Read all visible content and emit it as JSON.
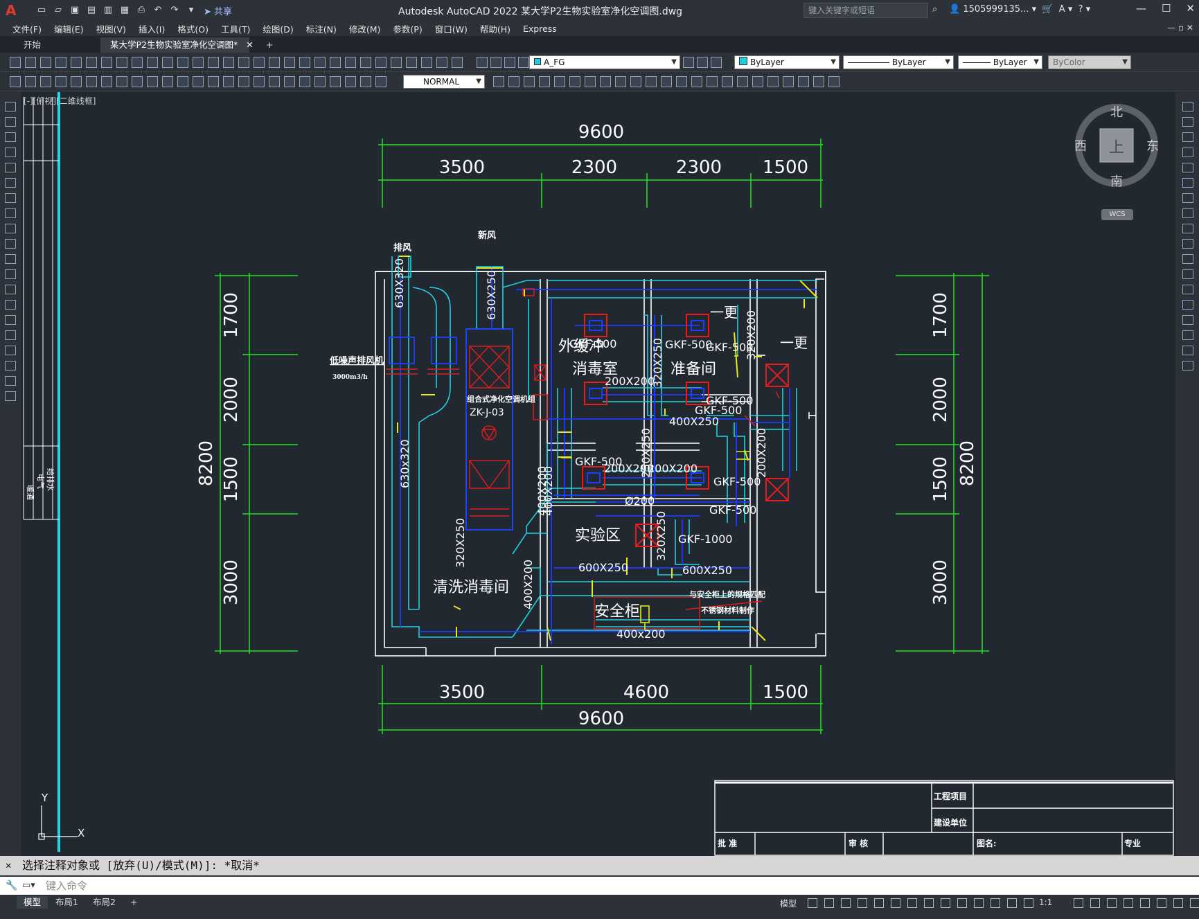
{
  "titlebar": {
    "app_logo": "A",
    "share": "共享",
    "title": "Autodesk AutoCAD 2022    某大学P2生物实验室净化空调图.dwg",
    "search_placeholder": "键入关键字或短语",
    "user": "1505999135...",
    "minimize": "—",
    "maximize": "☐",
    "close": "✕"
  },
  "menu": [
    "文件(F)",
    "编辑(E)",
    "视图(V)",
    "插入(I)",
    "格式(O)",
    "工具(T)",
    "绘图(D)",
    "标注(N)",
    "修改(M)",
    "参数(P)",
    "窗口(W)",
    "帮助(H)",
    "Express"
  ],
  "tabs": {
    "start": "开始",
    "doc": "某大学P2生物实验室净化空调图*",
    "close": "✕",
    "add": "+"
  },
  "ribbon": {
    "layer": "A_FG",
    "color": "ByLayer",
    "linetype": "ByLayer",
    "lineweight": "ByLayer",
    "plotstyle": "ByColor",
    "textstyle": "NORMAL"
  },
  "viewport_label": "[-][俯视][二维线框]",
  "compass": {
    "north": "北",
    "south": "南",
    "east": "东",
    "west": "西",
    "top": "上",
    "wcs": "WCS"
  },
  "drawing": {
    "dims_top_total": "9600",
    "dims_top": [
      "3500",
      "2300",
      "2300",
      "1500"
    ],
    "dims_bottom": [
      "3500",
      "4600",
      "1500"
    ],
    "dims_bottom_total": "9600",
    "dims_left": [
      "1700",
      "2000",
      "1500",
      "3000"
    ],
    "dims_left_total": "8200",
    "dims_right": [
      "1700",
      "2000",
      "1500",
      "3000"
    ],
    "dims_right_total": "8200",
    "labels": {
      "exhaust": "排风",
      "fresh_air": "新风",
      "fan": "低噪声排风机",
      "fan_flow": "3000m3/h",
      "ahu": "组合式净化空调机组",
      "ahu_code": "ZK-J-03",
      "room_buffer": "外缓冲",
      "room_disinfect": "消毒室",
      "room_prep": "准备间",
      "room_change1": "一更",
      "room_change2": "一更",
      "room_lab": "实验区",
      "room_wash": "清洗消毒间",
      "cabinet": "安全柜",
      "note1": "与安全柜上的规格匹配",
      "note2": "不锈钢材料制作"
    },
    "ducts": [
      "630X320",
      "630X250",
      "630x320",
      "400X200",
      "GKF-500",
      "GKF-500",
      "200X200",
      "GKF-500",
      "GKF-500",
      "320X250",
      "400X250",
      "320X200",
      "GKF-500",
      "GKF-500",
      "GKF-500",
      "200X200",
      "250X250",
      "200X200",
      "GKF-500",
      "200X200",
      "400X200",
      "Ø200",
      "600X250",
      "GKF-1000",
      "320X250",
      "600X250",
      "320X250",
      "400X200",
      "400x200"
    ]
  },
  "titleblock": {
    "project": "工程项目",
    "unit": "建设单位",
    "approve": "批 准",
    "review": "审 核",
    "drawing_name": "图名:",
    "discipline": "专业"
  },
  "ucs": {
    "y": "Y",
    "x": "X"
  },
  "side_legend": [
    "暖通",
    "电气",
    "给排水"
  ],
  "command": {
    "history": "选择注释对象或 [放弃(U)/模式(M)]: *取消*",
    "placeholder": "键入命令"
  },
  "status": {
    "layouts": [
      "模型",
      "布局1",
      "布局2"
    ],
    "model": "模型",
    "scale": "1:1"
  },
  "colors": {
    "dim": "#22e422",
    "duct": "#22cfe0",
    "duct_blue": "#1e3cff",
    "red": "#e41c1c",
    "yellow": "#e8e81a",
    "wall": "#ffffff"
  }
}
